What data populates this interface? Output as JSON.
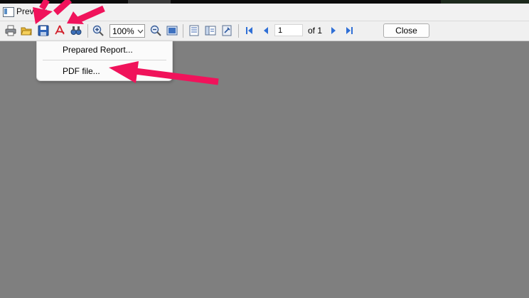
{
  "window": {
    "title": "Preview"
  },
  "toolbar": {
    "icons": [
      "printer-icon",
      "open-folder-icon",
      "save-icon",
      "pdf-icon",
      "find-icon",
      "zoom-in-icon",
      "zoom-out-icon",
      "full-screen-icon",
      "outline-icon",
      "thumbnails-icon",
      "page-setup-icon",
      "first-page-icon",
      "previous-page-icon",
      "next-page-icon",
      "last-page-icon"
    ],
    "zoom_value": "100%",
    "page_current": "1",
    "page_of": "of 1",
    "close_label": "Close"
  },
  "save_menu": {
    "items": [
      {
        "label": "Prepared Report..."
      },
      {
        "label": "PDF file..."
      }
    ]
  },
  "colors": {
    "background": "#7f7f7f",
    "annotation_arrow": "#f0135b",
    "nav_blue": "#2f6fd6"
  }
}
